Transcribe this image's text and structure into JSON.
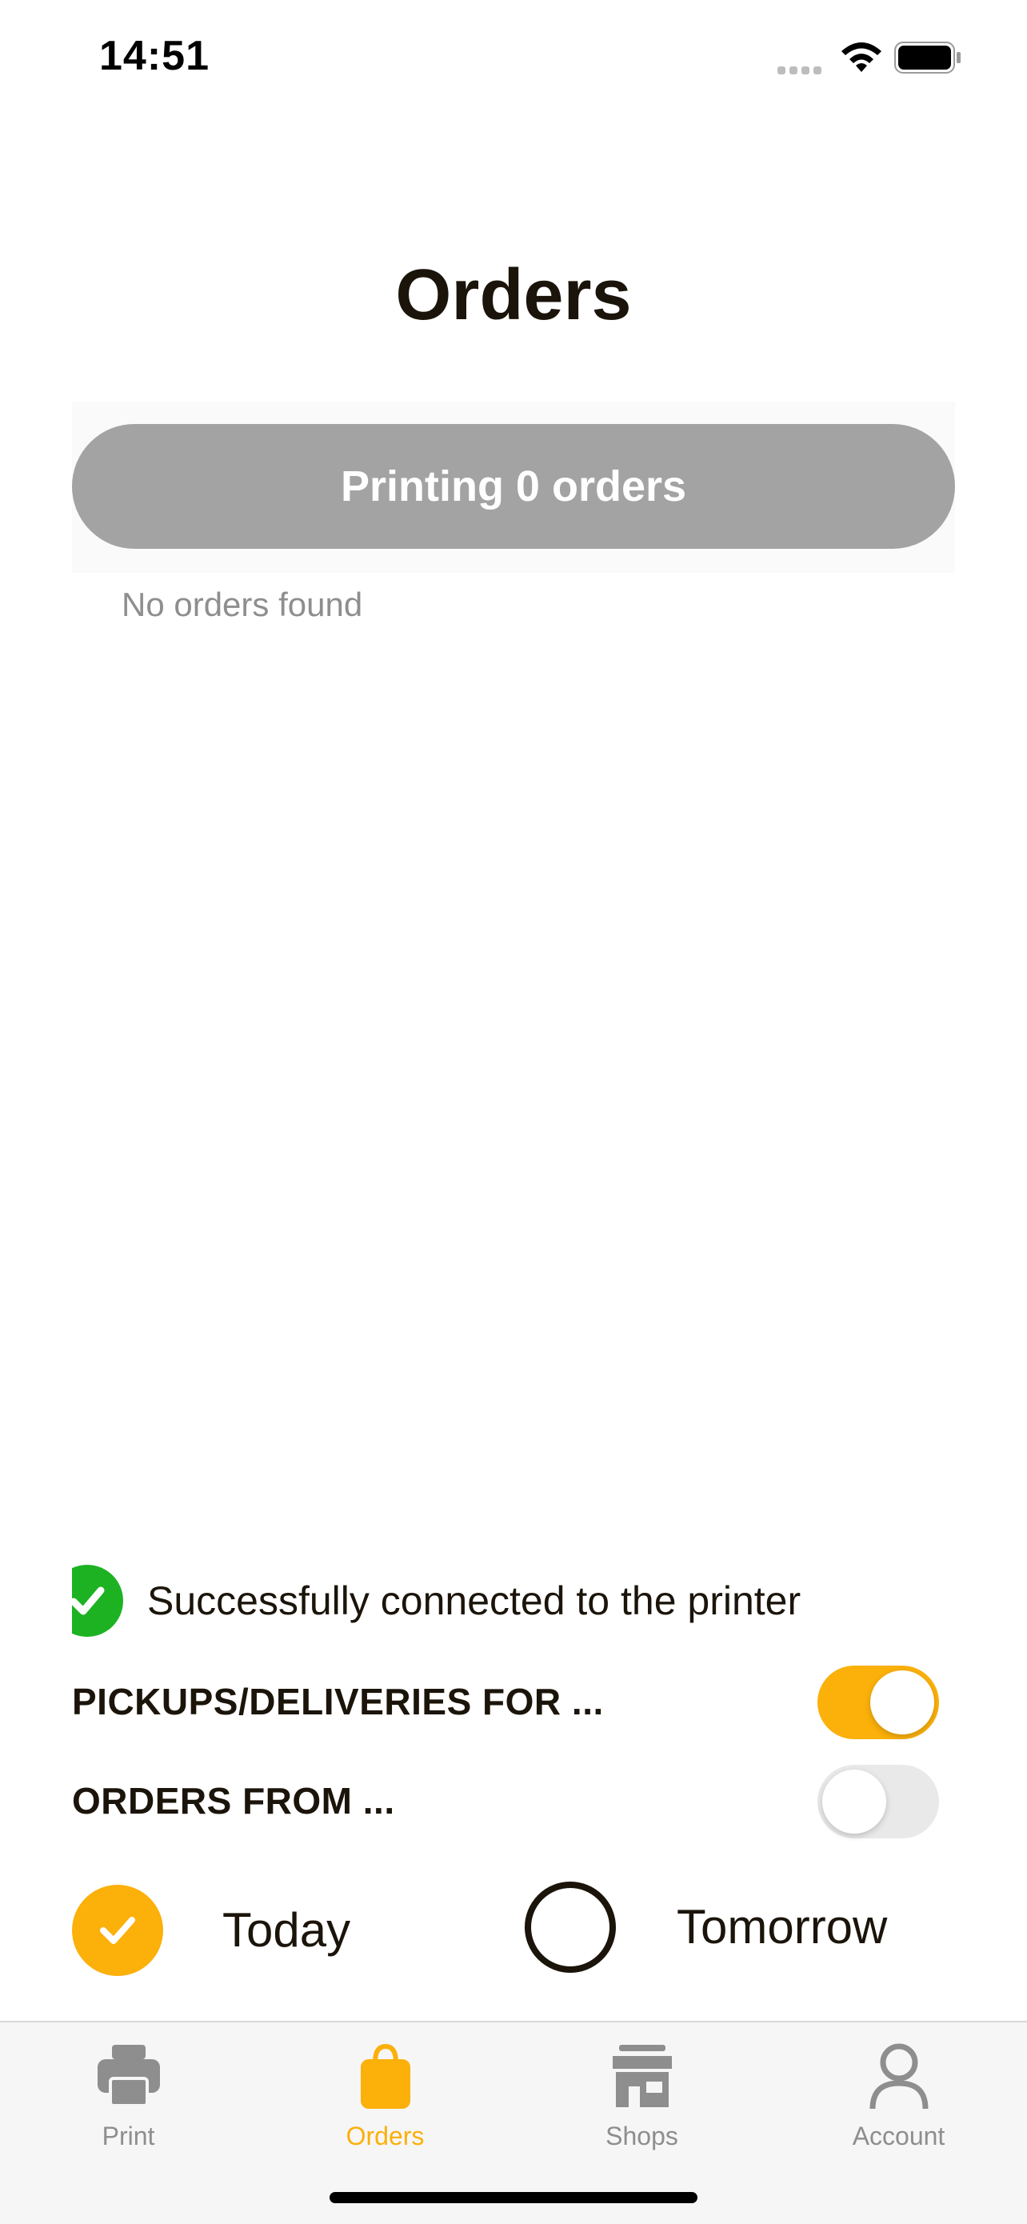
{
  "status_bar": {
    "time": "14:51"
  },
  "header": {
    "title": "Orders"
  },
  "print_button": {
    "label": "Printing 0 orders"
  },
  "orders": {
    "empty_message": "No orders found"
  },
  "printer_status": {
    "message": "Successfully connected to the printer",
    "status_color": "#1db222"
  },
  "settings": {
    "pickups_deliveries": {
      "label": "PICKUPS/DELIVERIES FOR ...",
      "enabled": true
    },
    "orders_from": {
      "label": "ORDERS FROM ...",
      "enabled": false
    }
  },
  "day_options": [
    {
      "label": "Today",
      "selected": true
    },
    {
      "label": "Tomorrow",
      "selected": false
    }
  ],
  "tabs": [
    {
      "label": "Print",
      "icon": "printer-icon",
      "active": false
    },
    {
      "label": "Orders",
      "icon": "shopping-bag-icon",
      "active": true
    },
    {
      "label": "Shops",
      "icon": "store-icon",
      "active": false
    },
    {
      "label": "Account",
      "icon": "person-icon",
      "active": false
    }
  ],
  "colors": {
    "accent": "#fbb00a",
    "disabled_button": "#a3a3a3",
    "success": "#1db222",
    "text": "#1b140a",
    "tab_inactive": "#8e8e8e"
  }
}
